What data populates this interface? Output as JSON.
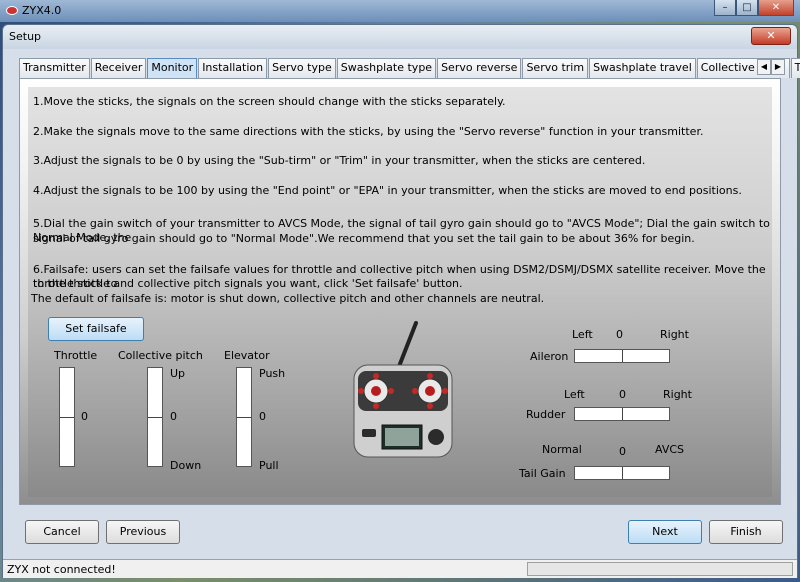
{
  "app": {
    "title": "ZYX4.0"
  },
  "outer_controls": {
    "minimize": "–",
    "maximize": "□",
    "close": "✕"
  },
  "dialog": {
    "title": "Setup",
    "close": "✕"
  },
  "tabs": [
    "Transmitter",
    "Receiver",
    "Monitor",
    "Installation",
    "Servo type",
    "Swashplate type",
    "Servo reverse",
    "Servo trim",
    "Swashplate travel",
    "Collective pitch",
    "Tail se"
  ],
  "tab_scroll": {
    "left": "◀",
    "right": "▶"
  },
  "instructions": {
    "i1": "1.Move the sticks, the signals on the screen should change with the sticks separately.",
    "i2": "2.Make the signals move to the same directions with the sticks, by using the \"Servo reverse\" function in your transmitter.",
    "i3": "3.Adjust the signals to be 0 by using the \"Sub-tirm\" or \"Trim\" in your transmitter, when the sticks are centered.",
    "i4": "4.Adjust the signals to be 100 by using the \"End point\" or \"EPA\" in your transmitter, when the sticks are moved to end positions.",
    "i5a": "5.Dial the gain switch of your transmitter to AVCS Mode, the signal of tail gyro gain should go to \"AVCS Mode\";  Dial the gain switch to Normal Mode, the",
    "i5b": "signal of tail gyro gain should go to \"Normal Mode\".We recommend that you set the tail gain to be about 36% for begin.",
    "i6a": "6.Failsafe: users can set the failsafe values for throttle and collective pitch when using DSM2/DSMJ/DSMX satellite receiver. Move the throttle stick to",
    "i6b": "to the throttle and collective pitch signals you want, click 'Set failsafe' button.",
    "i6c": "The default of failsafe is: motor is shut down, collective pitch and other channels are neutral."
  },
  "set_failsafe": "Set failsafe",
  "sliders": {
    "throttle": {
      "label": "Throttle",
      "value": "0"
    },
    "collective": {
      "label": "Collective pitch",
      "top": "Up",
      "value": "0",
      "bottom": "Down"
    },
    "elevator": {
      "label": "Elevator",
      "top": "Push",
      "value": "0",
      "bottom": "Pull"
    }
  },
  "channels": {
    "aileron": {
      "label": "Aileron",
      "left": "Left",
      "value": "0",
      "right": "Right"
    },
    "rudder": {
      "label": "Rudder",
      "left": "Left",
      "value": "0",
      "right": "Right"
    },
    "tailgain": {
      "label": "Tail Gain",
      "left": "Normal",
      "value": "0",
      "right": "AVCS"
    }
  },
  "buttons": {
    "cancel": "Cancel",
    "previous": "Previous",
    "next": "Next",
    "finish": "Finish"
  },
  "status": {
    "text": "ZYX not connected!"
  }
}
